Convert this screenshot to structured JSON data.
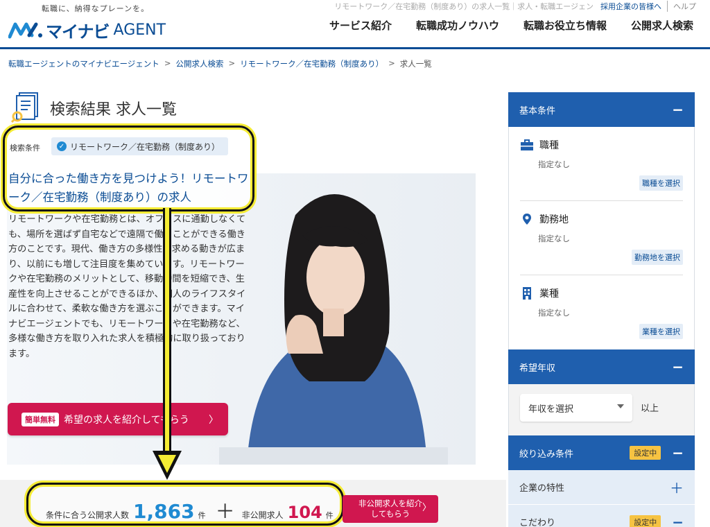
{
  "header": {
    "tagline": "転職に、納得なプレーンを。",
    "logo_main": "マイナビ",
    "logo_agent": "AGENT",
    "top_link_job": "リモートワーク／在宅勤務（制度あり）の求人一覧｜求人・転職エージェン",
    "top_link_corp": "採用企業の皆様へ",
    "top_link_help": "ヘルプ",
    "nav": [
      "サービス紹介",
      "転職成功ノウハウ",
      "転職お役立ち情報",
      "公開求人検索"
    ]
  },
  "breadcrumb": [
    {
      "label": "転職エージェントのマイナビエージェント",
      "link": true
    },
    {
      "label": "公開求人検索",
      "link": true
    },
    {
      "label": "リモートワーク／在宅勤務（制度あり）",
      "link": true
    },
    {
      "label": "求人一覧",
      "link": false
    }
  ],
  "breadcrumb_sep": ">",
  "page_title": "検索結果 求人一覧",
  "condition": {
    "label": "検索条件",
    "tag": "リモートワーク／在宅勤務（制度あり）",
    "heading": "自分に合った働き方を見つけよう！リモートワーク／在宅勤務（制度あり）の求人"
  },
  "description": "リモートワークや在宅勤務とは、オフィスに通勤しなくても、場所を選ばず自宅などで遠隔で働くことができる働き方のことです。現代、働き方の多様性を求める動きが広まり、以前にも増して注目度を集めています。リモートワークや在宅勤務のメリットとして、移動時間を短縮でき、生産性を向上させることができるほか、個人のライフスタイルに合わせて、柔軟な働き方を選ぶことができます。マイナビエージェントでも、リモートワークや在宅勤務など、多様な働き方を取り入れた求人を積極的に取り扱っております。",
  "cta": {
    "badge": "簡単無料",
    "label": "希望の求人を紹介してもらう",
    "arrow": "〉"
  },
  "counts": {
    "public_label": "条件に合う公開求人数",
    "public_count": "1,863",
    "unit": "件",
    "plus": "＋",
    "secret_label": "非公開求人",
    "secret_count": "104",
    "secret_button": "非公開求人を紹介してもらう",
    "secret_arrow": "〉"
  },
  "sidebar": {
    "basic_title": "基本条件",
    "collapse": "−",
    "items": [
      {
        "title": "職種",
        "sub": "指定なし",
        "button": "職種を選択",
        "icon": "briefcase-icon"
      },
      {
        "title": "勤務地",
        "sub": "指定なし",
        "button": "勤務地を選択",
        "icon": "map-pin-icon"
      },
      {
        "title": "業種",
        "sub": "指定なし",
        "button": "業種を選択",
        "icon": "building-icon"
      }
    ],
    "salary_title": "希望年収",
    "salary_select": "年収を選択",
    "salary_suffix": "以上",
    "filter_title": "絞り込み条件",
    "active_tag": "設定中",
    "rows": [
      {
        "label": "企業の特性",
        "toggle": "＋",
        "active": false
      },
      {
        "label": "こだわり",
        "toggle": "−",
        "active": true
      }
    ]
  },
  "colors": {
    "brand_blue": "#0a4c94",
    "accent_blue": "#1f8ad2",
    "cta_red": "#d0174f",
    "highlight_yellow": "#f5ec34"
  }
}
